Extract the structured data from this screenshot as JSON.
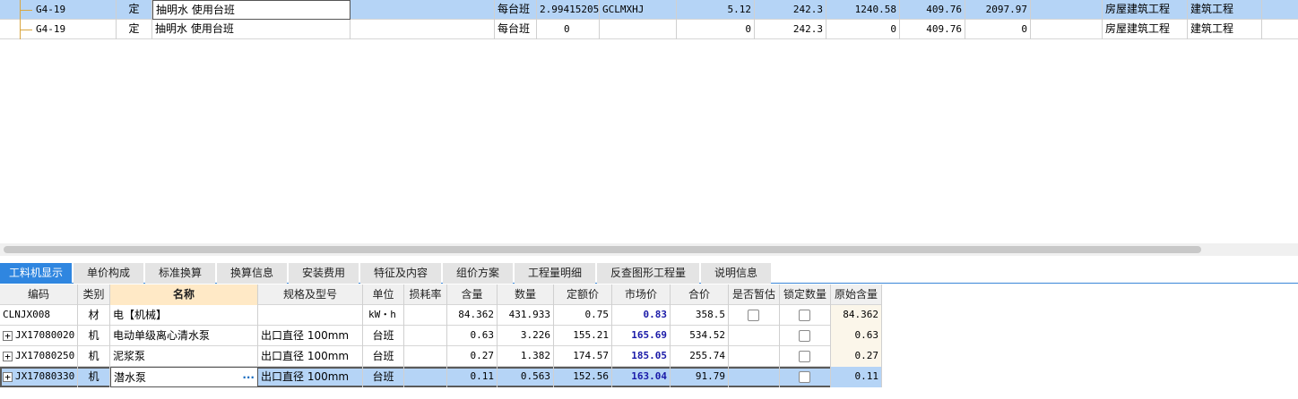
{
  "upper_rows": [
    {
      "code": "G4-19",
      "type": "定",
      "name": "抽明水 使用台班",
      "spec": "",
      "unit": "每台班",
      "qty_expr": "2.99415205",
      "code_expr": "GCLMXHJ",
      "qty": "5.12",
      "price": "242.3",
      "total": "1240.58",
      "unit_price2": "409.76",
      "total2": "2097.97",
      "blank": "",
      "project_type": "房屋建筑工程",
      "category": "建筑工程",
      "selected": true
    },
    {
      "code": "G4-19",
      "type": "定",
      "name": "抽明水 使用台班",
      "spec": "",
      "unit": "每台班",
      "qty_expr": "0",
      "code_expr": "",
      "qty": "0",
      "price": "242.3",
      "total": "0",
      "unit_price2": "409.76",
      "total2": "0",
      "blank": "",
      "project_type": "房屋建筑工程",
      "category": "建筑工程",
      "selected": false
    }
  ],
  "tabs": [
    "工料机显示",
    "单价构成",
    "标准换算",
    "换算信息",
    "安装费用",
    "特征及内容",
    "组价方案",
    "工程量明细",
    "反查图形工程量",
    "说明信息"
  ],
  "lower_headers": [
    "编码",
    "类别",
    "名称",
    "规格及型号",
    "单位",
    "损耗率",
    "含量",
    "数量",
    "定额价",
    "市场价",
    "合价",
    "是否暂估",
    "锁定数量",
    "原始含量"
  ],
  "lower_rows": [
    {
      "code": "CLNJX008",
      "type": "材",
      "name": "电【机械】",
      "spec": "",
      "unit": "kW・h",
      "loss": "",
      "content": "84.362",
      "qty": "431.933",
      "quota_price": "0.75",
      "market_price": "0.83",
      "total": "358.5",
      "is_estimate": false,
      "lock_qty": false,
      "orig_content": "84.362",
      "expandable": false
    },
    {
      "code": "JX17080020",
      "type": "机",
      "name": "电动单级离心清水泵",
      "spec": "出口直径 100mm",
      "unit": "台班",
      "loss": "",
      "content": "0.63",
      "qty": "3.226",
      "quota_price": "155.21",
      "market_price": "165.69",
      "total": "534.52",
      "is_estimate": null,
      "lock_qty": false,
      "orig_content": "0.63",
      "expandable": true
    },
    {
      "code": "JX17080250",
      "type": "机",
      "name": "泥浆泵",
      "spec": "出口直径 100mm",
      "unit": "台班",
      "loss": "",
      "content": "0.27",
      "qty": "1.382",
      "quota_price": "174.57",
      "market_price": "185.05",
      "total": "255.74",
      "is_estimate": null,
      "lock_qty": false,
      "orig_content": "0.27",
      "expandable": true
    },
    {
      "code": "JX17080330",
      "type": "机",
      "name": "潜水泵",
      "spec": "出口直径 100mm",
      "unit": "台班",
      "loss": "",
      "content": "0.11",
      "qty": "0.563",
      "quota_price": "152.56",
      "market_price": "163.04",
      "total": "91.79",
      "is_estimate": null,
      "lock_qty": false,
      "orig_content": "0.11",
      "expandable": true,
      "selected": true
    }
  ],
  "icons": {
    "expand": "plus-box-icon",
    "more": "ellipsis-icon",
    "checkbox": "checkbox-icon"
  },
  "colors": {
    "selected_row": "#b5d4f6",
    "active_tab": "#2f86e0",
    "name_header": "#ffe9c6",
    "market_price": "#1a1aa8",
    "tree_line": "#d9a640"
  }
}
